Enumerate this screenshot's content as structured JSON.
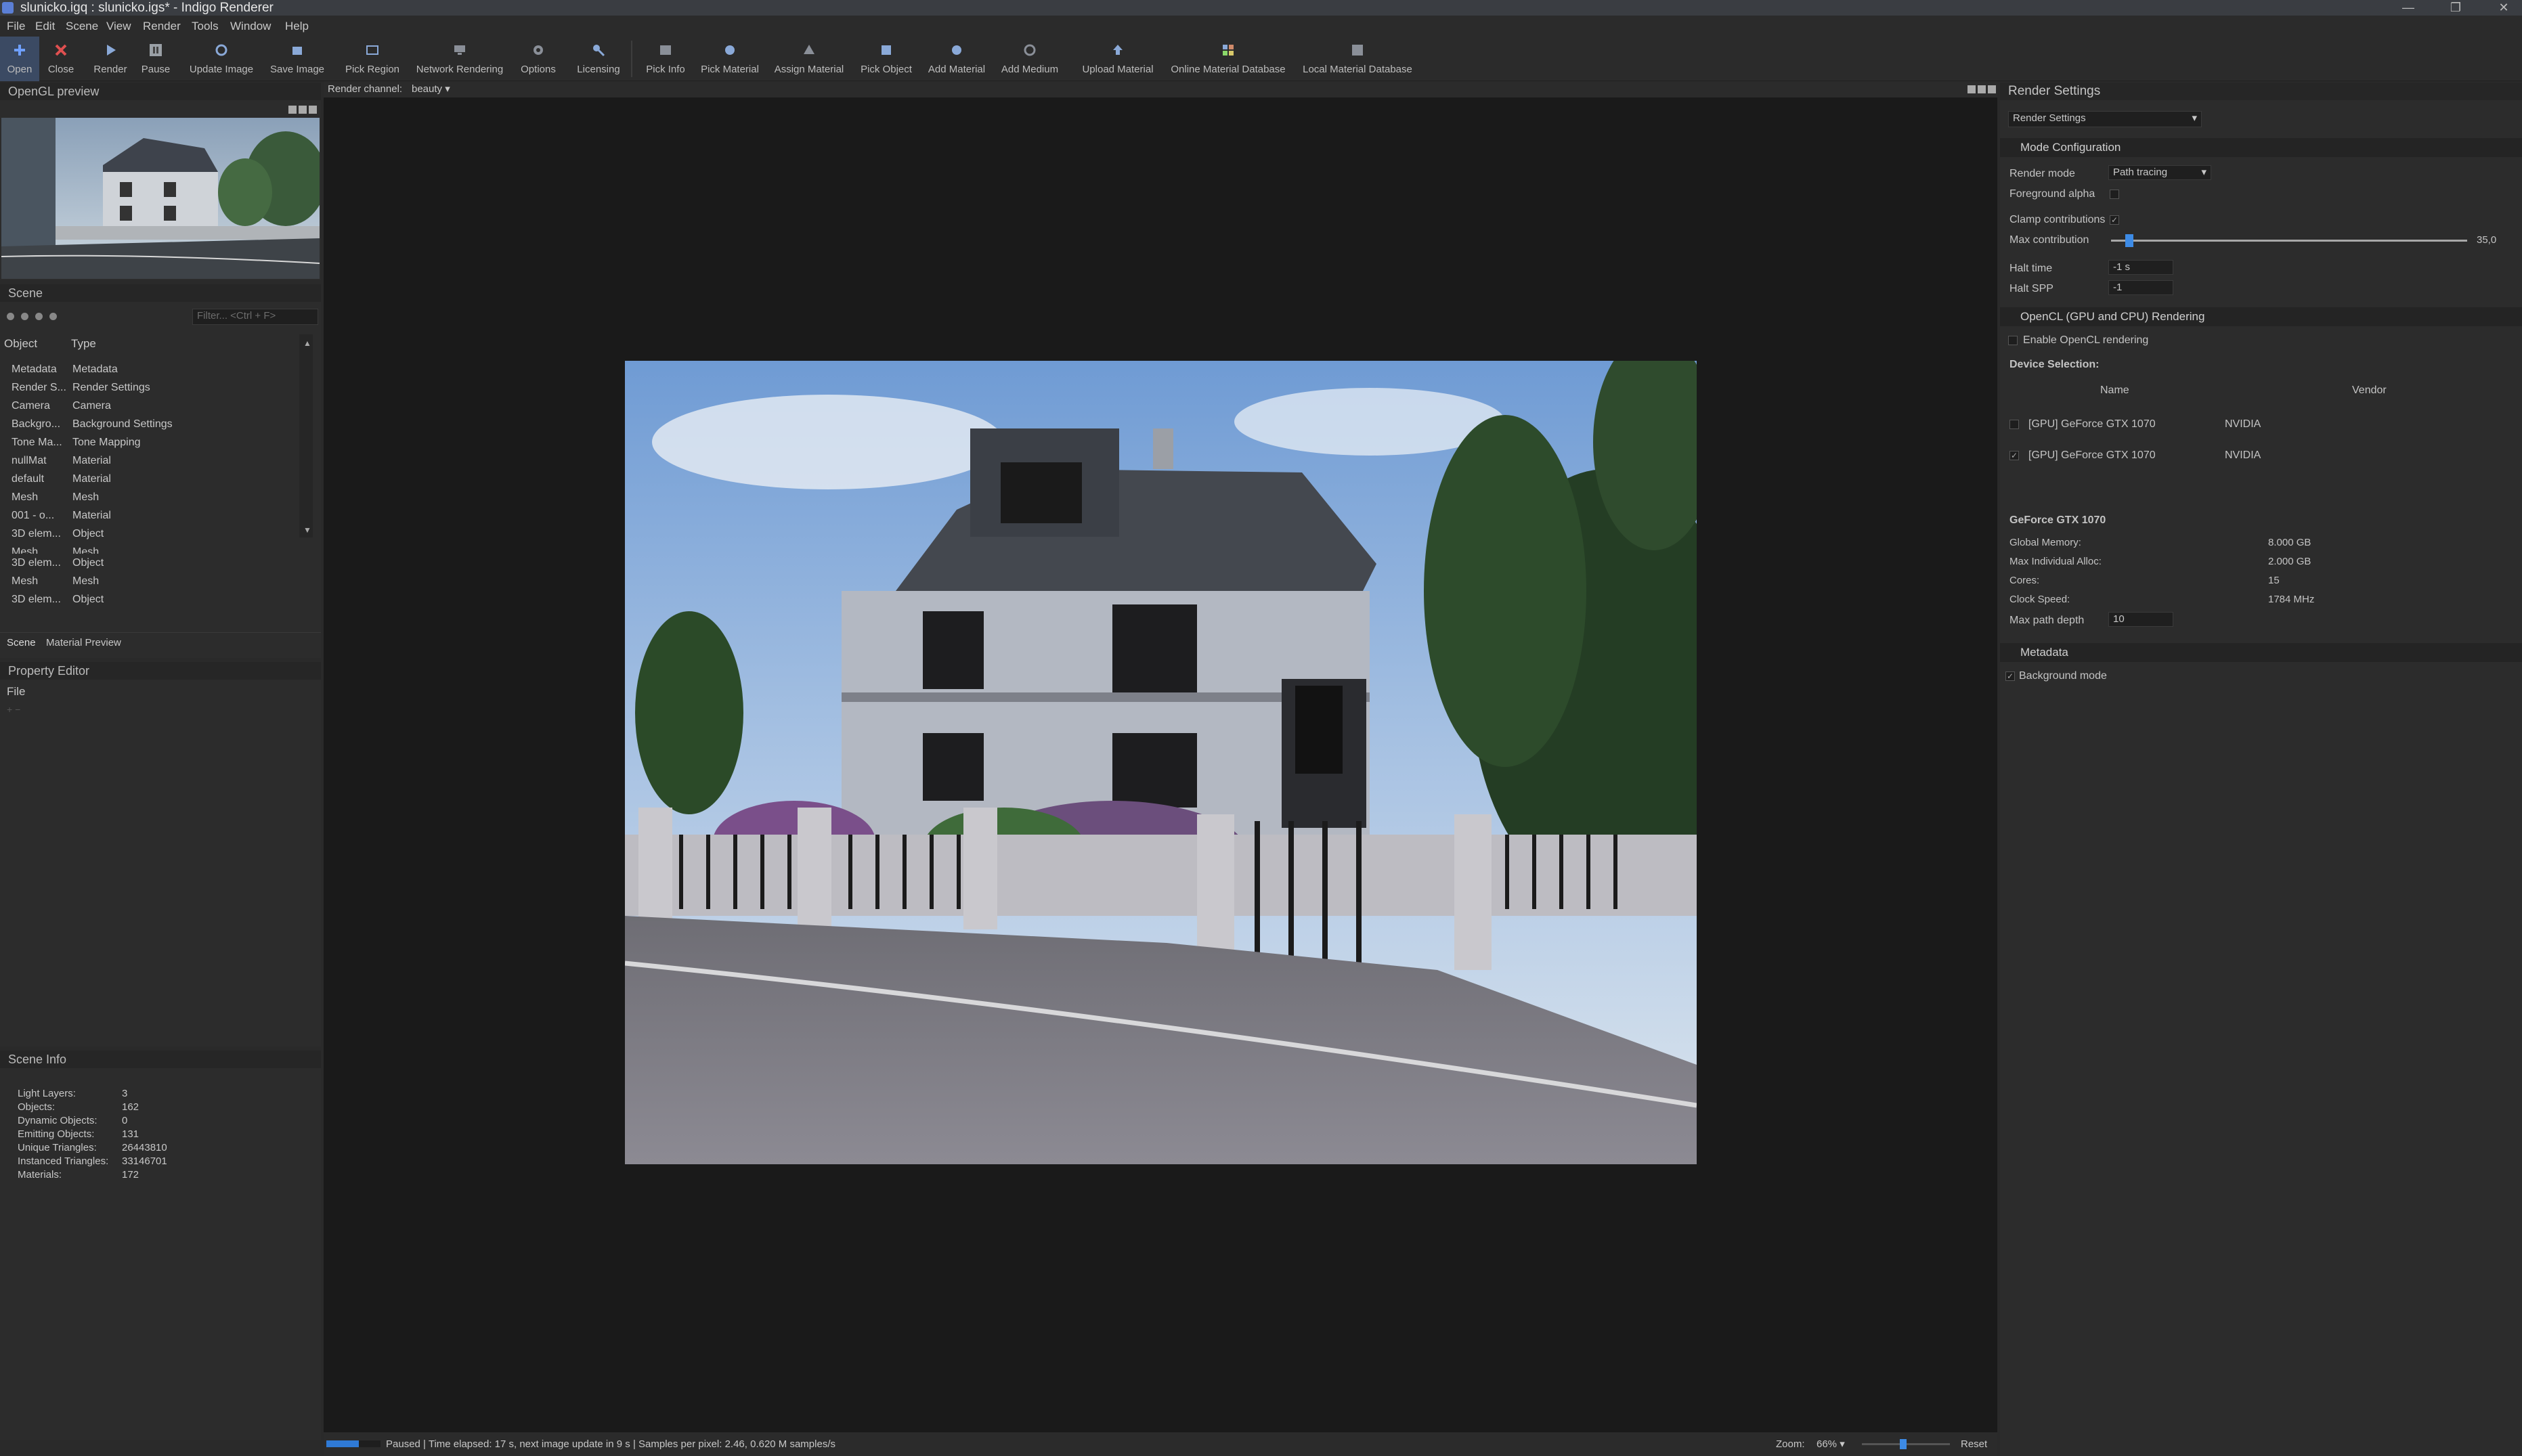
{
  "window": {
    "title": "slunicko.igq : slunicko.igs* - Indigo Renderer"
  },
  "menu": [
    "File",
    "Edit",
    "Scene",
    "View",
    "Render",
    "Tools",
    "Window",
    "Help"
  ],
  "toolbar": [
    "Open",
    "Close",
    "Render",
    "Pause",
    "Update Image",
    "Save Image",
    "Pick Region",
    "Network Rendering",
    "Options",
    "Licensing",
    "Pick Info",
    "Pick Material",
    "Assign Material",
    "Pick Object",
    "Add Material",
    "Add Medium",
    "Upload Material",
    "Online Material Database",
    "Local Material Database"
  ],
  "opengl": {
    "title": "OpenGL preview"
  },
  "scene": {
    "title": "Scene",
    "filter_placeholder": "Filter... <Ctrl + F>",
    "col_object": "Object",
    "col_type": "Type",
    "rows": [
      [
        "Metadata",
        "Metadata"
      ],
      [
        "Render S...",
        "Render Settings"
      ],
      [
        "Camera",
        "Camera"
      ],
      [
        "Backgro...",
        "Background Settings"
      ],
      [
        "Tone Ma...",
        "Tone Mapping"
      ],
      [
        "nullMat",
        "Material"
      ],
      [
        "default",
        "Material"
      ],
      [
        "Mesh",
        "Mesh"
      ],
      [
        "001 - o...",
        "Material"
      ],
      [
        "3D elem...",
        "Object"
      ],
      [
        "Mesh",
        "Mesh"
      ],
      [
        "3D elem...",
        "Object"
      ],
      [
        "Mesh",
        "Mesh"
      ],
      [
        "3D elem...",
        "Object"
      ]
    ],
    "tabs": [
      "Scene",
      "Material Preview"
    ]
  },
  "property_editor": {
    "title": "Property Editor",
    "file_label": "File"
  },
  "scene_info": {
    "title": "Scene Info",
    "rows": [
      [
        "Light Layers:",
        "3"
      ],
      [
        "Objects:",
        "162"
      ],
      [
        "Dynamic Objects:",
        "0"
      ],
      [
        "Emitting Objects:",
        "131"
      ],
      [
        "Unique Triangles:",
        "26443810"
      ],
      [
        "Instanced Triangles:",
        "33146701"
      ],
      [
        "Materials:",
        "172"
      ]
    ]
  },
  "render_channel": {
    "label": "Render channel:",
    "value": "beauty"
  },
  "status": {
    "text": "Paused | Time elapsed: 17 s, next image update in 9 s | Samples per pixel: 2.46, 0.620 M samples/s",
    "progress": 0.6,
    "zoom_label": "Zoom:",
    "zoom_value": "66%",
    "reset": "Reset"
  },
  "render_settings": {
    "title": "Render Settings",
    "dropdown": "Render Settings",
    "mode_config": "Mode Configuration",
    "render_mode_label": "Render mode",
    "render_mode_value": "Path tracing",
    "foreground_alpha_label": "Foreground alpha",
    "clamp_label": "Clamp contributions",
    "max_contrib_label": "Max contribution",
    "max_contrib_value": "35,0",
    "max_contrib_fraction": 0.04,
    "halt_time_label": "Halt time",
    "halt_time_value": "-1 s",
    "halt_spp_label": "Halt SPP",
    "halt_spp_value": "-1",
    "opencl_section": "OpenCL (GPU and CPU) Rendering",
    "enable_opencl": "Enable OpenCL rendering",
    "device_selection": "Device Selection:",
    "col_name": "Name",
    "col_vendor": "Vendor",
    "devices": [
      {
        "name": "[GPU] GeForce GTX 1070",
        "vendor": "NVIDIA",
        "checked": false
      },
      {
        "name": "[GPU] GeForce GTX 1070",
        "vendor": "NVIDIA",
        "checked": true
      }
    ],
    "gpu_title": "GeForce GTX 1070",
    "gpu_info": [
      [
        "Global Memory:",
        "8.000 GB"
      ],
      [
        "Max Individual Alloc:",
        "2.000 GB"
      ],
      [
        "Cores:",
        "15"
      ],
      [
        "Clock Speed:",
        "1784 MHz"
      ]
    ],
    "max_path_label": "Max path depth",
    "max_path_value": "10",
    "metadata_section": "Metadata",
    "background_mode": "Background mode"
  }
}
